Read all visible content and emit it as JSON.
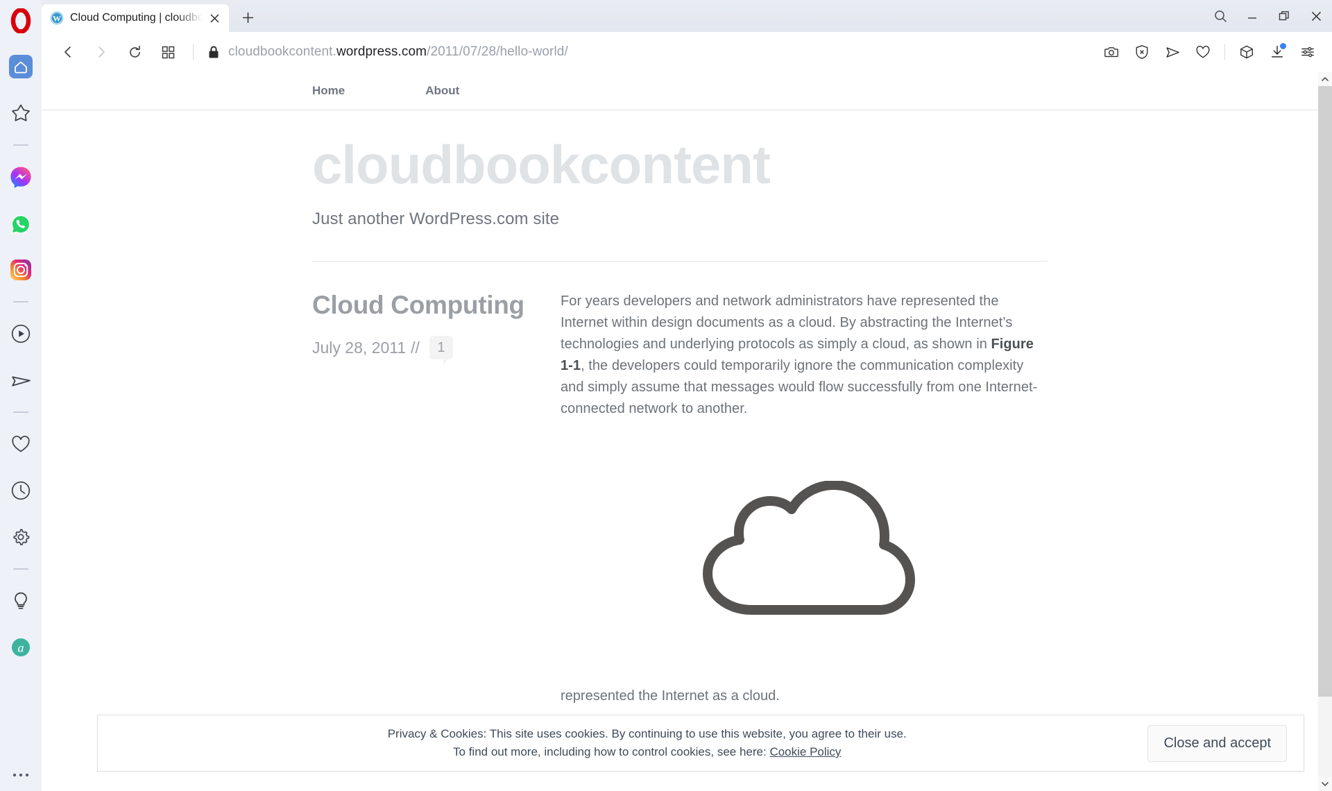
{
  "browser": {
    "name": "Opera",
    "logo_icon": "opera-logo",
    "tab": {
      "title": "Cloud Computing | cloudbookcontent",
      "favicon": "wordpress-favicon",
      "close_icon": "close-icon"
    },
    "new_tab_icon": "plus-icon",
    "window_controls": [
      {
        "name": "search-icon",
        "label": "Search"
      },
      {
        "name": "minimize-icon",
        "label": "Minimize"
      },
      {
        "name": "restore-icon",
        "label": "Restore"
      },
      {
        "name": "close-window-icon",
        "label": "Close"
      }
    ],
    "nav": {
      "back_icon": "back-arrow-icon",
      "forward_icon": "forward-arrow-icon",
      "reload_icon": "reload-icon",
      "tabs_overview_icon": "grid-icon",
      "lock_icon": "lock-icon",
      "url": {
        "prefix": "cloudbookcontent.",
        "domain": "wordpress.com",
        "path": "/2011/07/28/hello-world/",
        "full": "cloudbookcontent.wordpress.com/2011/07/28/hello-world/"
      }
    },
    "toolbar_icons": [
      {
        "name": "snapshot-camera-icon",
        "label": "Snapshot"
      },
      {
        "name": "ad-blocker-shield-icon",
        "label": "Ad blocker"
      },
      {
        "name": "send-paper-plane-icon",
        "label": "My Flow"
      },
      {
        "name": "heart-icon",
        "label": "Favorites"
      },
      {
        "name": "extensions-cube-icon",
        "label": "Extensions"
      },
      {
        "name": "downloads-icon",
        "label": "Downloads",
        "badge": true
      },
      {
        "name": "easy-setup-sliders-icon",
        "label": "Easy setup"
      }
    ],
    "sidebar_items": [
      {
        "name": "sidebar-item-home",
        "icon": "home-icon",
        "label": "Home",
        "active": true
      },
      {
        "name": "sidebar-item-speed-dial",
        "icon": "star-icon",
        "label": "Speed Dial"
      },
      {
        "name": "sidebar-divider-1",
        "icon": "divider"
      },
      {
        "name": "sidebar-item-messenger",
        "icon": "messenger-icon",
        "label": "Messenger"
      },
      {
        "name": "sidebar-item-whatsapp",
        "icon": "whatsapp-icon",
        "label": "WhatsApp"
      },
      {
        "name": "sidebar-item-instagram",
        "icon": "instagram-icon",
        "label": "Instagram"
      },
      {
        "name": "sidebar-divider-2",
        "icon": "divider"
      },
      {
        "name": "sidebar-item-player",
        "icon": "player-icon",
        "label": "Player"
      },
      {
        "name": "sidebar-item-telegram",
        "icon": "telegram-icon",
        "label": "Telegram"
      },
      {
        "name": "sidebar-divider-3",
        "icon": "divider"
      },
      {
        "name": "sidebar-item-bookmarks",
        "icon": "heart-icon",
        "label": "Bookmarks"
      },
      {
        "name": "sidebar-item-history",
        "icon": "clock-icon",
        "label": "History"
      },
      {
        "name": "sidebar-item-settings",
        "icon": "gear-icon",
        "label": "Settings"
      },
      {
        "name": "sidebar-divider-4",
        "icon": "divider"
      },
      {
        "name": "sidebar-item-tips",
        "icon": "lightbulb-icon",
        "label": "Tips"
      },
      {
        "name": "sidebar-item-aria",
        "icon": "aria-icon",
        "label": "Aria"
      }
    ],
    "sidebar_more_icon": "more-dots-icon",
    "scrollbar": {
      "up_arrow_icon": "chevron-up-icon",
      "down_arrow_icon": "chevron-down-icon"
    }
  },
  "site": {
    "nav": [
      {
        "label": "Home"
      },
      {
        "label": "About"
      }
    ],
    "title": "cloudbookcontent",
    "tagline": "Just another WordPress.com site"
  },
  "post": {
    "title": "Cloud Computing",
    "date": "July 28, 2011",
    "separator": "//",
    "comment_count": "1",
    "paragraph_part1": "For years developers and network administrators have represented the Internet within design documents as a cloud. By abstracting the Internet’s technologies and underlying protocols as simply a cloud, as shown in ",
    "paragraph_bold": "Figure 1-1",
    "paragraph_part2": ", the developers could temporarily ignore the communication complexity and simply assume that messages would flow successfully from one Internet-connected network to another.",
    "figure_icon": "cloud-outline-icon",
    "paragraph2": "represented the Internet as a cloud."
  },
  "cookie_banner": {
    "line1": "Privacy & Cookies: This site uses cookies. By continuing to use this website, you agree to their use.",
    "line2_prefix": "To find out more, including how to control cookies, see here: ",
    "policy_link": "Cookie Policy",
    "accept_label": "Close and accept"
  },
  "colors": {
    "opera_red": "#E3000F",
    "sidebar_bg": "#EEF1F7",
    "active_blue": "#5B8DD9",
    "download_badge": "#3B82F6",
    "site_title": "#DFE3E6",
    "body_text": "#6D7278",
    "cloud_stroke": "#555352",
    "aria_green": "#3DB39E"
  }
}
